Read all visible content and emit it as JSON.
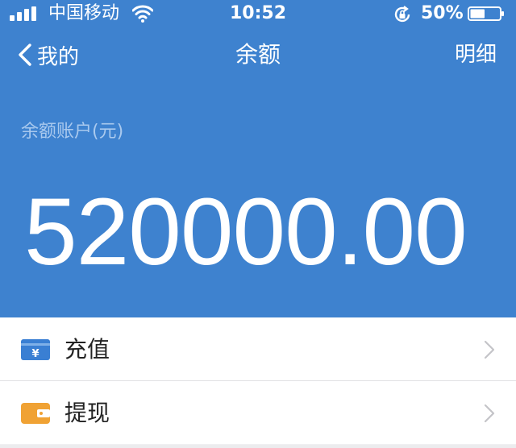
{
  "status_bar": {
    "carrier": "中国移动",
    "time": "10:52",
    "battery": "50%",
    "battery_level": 0.5
  },
  "nav": {
    "back_label": "我的",
    "title": "余额",
    "right_label": "明细"
  },
  "account": {
    "label": "余额账户(元)",
    "amount": "520000.00"
  },
  "list": {
    "items": [
      {
        "label": "充值",
        "icon": "yen-card-icon",
        "color": "#3a7fd3"
      },
      {
        "label": "提现",
        "icon": "wallet-icon",
        "color": "#f0a234"
      }
    ]
  },
  "colors": {
    "primary": "#3e82cf",
    "label_light": "#a9c9ee",
    "background": "#f0f0f2"
  }
}
